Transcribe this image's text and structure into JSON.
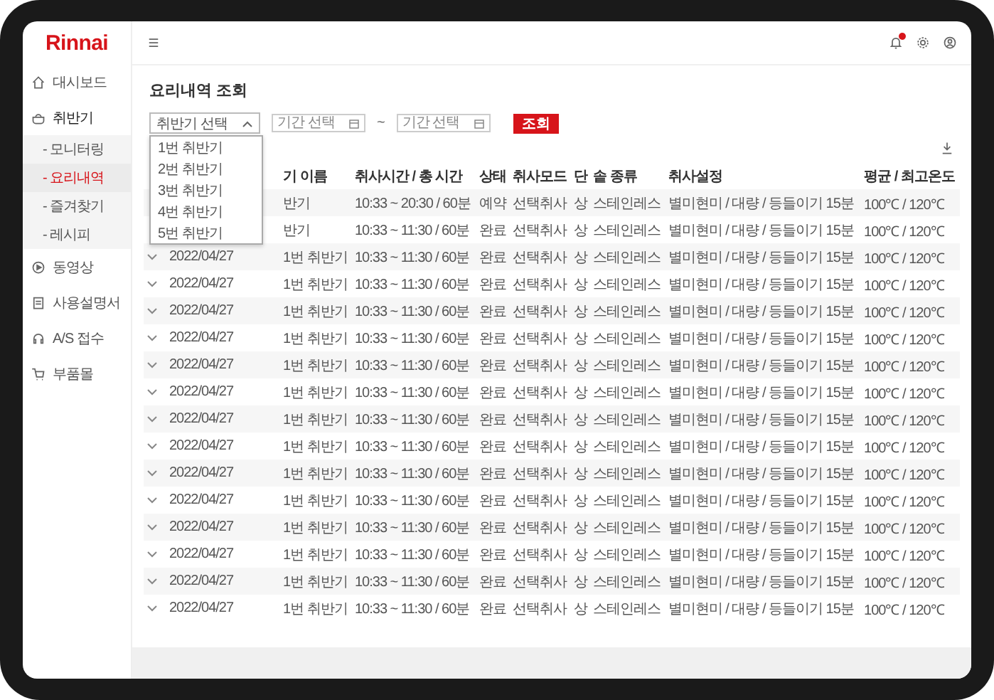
{
  "sidebar": {
    "logo": "Rinnai",
    "items": [
      {
        "label": "대시보드",
        "selected": false
      },
      {
        "label": "취반기",
        "selected": false,
        "expanded": true,
        "children": [
          {
            "label": "- 모니터링",
            "selected": false
          },
          {
            "label": "- 요리내역",
            "selected": true
          },
          {
            "label": "- 즐겨찾기",
            "selected": false
          },
          {
            "label": "- 레시피",
            "selected": false
          }
        ]
      },
      {
        "label": "동영상",
        "selected": false
      },
      {
        "label": "사용설명서",
        "selected": false
      },
      {
        "label": "A/S 접수",
        "selected": false
      },
      {
        "label": "부품몰",
        "selected": false
      }
    ]
  },
  "top_bar": {
    "notification": true
  },
  "page_title": "요리내역 조회",
  "filters": {
    "device_select": {
      "value": "취반기 선택",
      "expanded": true,
      "options": [
        {
          "label": "1번 취반기",
          "selected": false
        },
        {
          "label": "2번 취반기",
          "selected": false
        },
        {
          "label": "3번 취반기",
          "selected": false
        },
        {
          "label": "4번 취반기",
          "selected": false
        },
        {
          "label": "5번 취반기",
          "selected": false
        }
      ]
    },
    "date_from": {
      "placeholder": "기간 선택"
    },
    "separator": "~",
    "date_to": {
      "placeholder": "기간 선택"
    },
    "search_button": "조회"
  },
  "table": {
    "columns": [
      "기 이름",
      "취사시간 / 총 시간",
      "상태",
      "취사모드",
      "단",
      "솥 종류",
      "취사설정",
      "평균 / 최고온도"
    ],
    "rows": [
      {
        "name": "반기",
        "time": "10:33 ~ 20:30 / 60분",
        "status": "예약",
        "mode": "선택취사",
        "stage": "상",
        "pot": "스테인레스",
        "setting": "별미현미 / 대량 / 등들이기 15분",
        "temp": "100℃ / 120℃"
      },
      {
        "name": "반기",
        "time": "10:33 ~ 11:30 / 60분",
        "status": "완료",
        "mode": "선택취사",
        "stage": "상",
        "pot": "스테인레스",
        "setting": "별미현미 / 대량 / 등들이기 15분",
        "temp": "100℃ / 120℃"
      },
      {
        "expanded": false,
        "date": "2022/04/27",
        "name": "1번 취반기",
        "time": "10:33 ~ 11:30 / 60분",
        "status": "완료",
        "mode": "선택취사",
        "stage": "상",
        "pot": "스테인레스",
        "setting": "별미현미 / 대량 / 등들이기 15분",
        "temp": "100℃ / 120℃"
      },
      {
        "expanded": false,
        "date": "2022/04/27",
        "name": "1번 취반기",
        "time": "10:33 ~ 11:30 / 60분",
        "status": "완료",
        "mode": "선택취사",
        "stage": "상",
        "pot": "스테인레스",
        "setting": "별미현미 / 대량 / 등들이기 15분",
        "temp": "100℃ / 120℃"
      },
      {
        "expanded": false,
        "date": "2022/04/27",
        "name": "1번 취반기",
        "time": "10:33 ~ 11:30 / 60분",
        "status": "완료",
        "mode": "선택취사",
        "stage": "상",
        "pot": "스테인레스",
        "setting": "별미현미 / 대량 / 등들이기 15분",
        "temp": "100℃ / 120℃"
      },
      {
        "expanded": false,
        "date": "2022/04/27",
        "name": "1번 취반기",
        "time": "10:33 ~ 11:30 / 60분",
        "status": "완료",
        "mode": "선택취사",
        "stage": "상",
        "pot": "스테인레스",
        "setting": "별미현미 / 대량 / 등들이기 15분",
        "temp": "100℃ / 120℃"
      },
      {
        "expanded": false,
        "date": "2022/04/27",
        "name": "1번 취반기",
        "time": "10:33 ~ 11:30 / 60분",
        "status": "완료",
        "mode": "선택취사",
        "stage": "상",
        "pot": "스테인레스",
        "setting": "별미현미 / 대량 / 등들이기 15분",
        "temp": "100℃ / 120℃"
      },
      {
        "expanded": false,
        "date": "2022/04/27",
        "name": "1번 취반기",
        "time": "10:33 ~ 11:30 / 60분",
        "status": "완료",
        "mode": "선택취사",
        "stage": "상",
        "pot": "스테인레스",
        "setting": "별미현미 / 대량 / 등들이기 15분",
        "temp": "100℃ / 120℃"
      },
      {
        "expanded": false,
        "date": "2022/04/27",
        "name": "1번 취반기",
        "time": "10:33 ~ 11:30 / 60분",
        "status": "완료",
        "mode": "선택취사",
        "stage": "상",
        "pot": "스테인레스",
        "setting": "별미현미 / 대량 / 등들이기 15분",
        "temp": "100℃ / 120℃"
      },
      {
        "expanded": false,
        "date": "2022/04/27",
        "name": "1번 취반기",
        "time": "10:33 ~ 11:30 / 60분",
        "status": "완료",
        "mode": "선택취사",
        "stage": "상",
        "pot": "스테인레스",
        "setting": "별미현미 / 대량 / 등들이기 15분",
        "temp": "100℃ / 120℃"
      },
      {
        "expanded": false,
        "date": "2022/04/27",
        "name": "1번 취반기",
        "time": "10:33 ~ 11:30 / 60분",
        "status": "완료",
        "mode": "선택취사",
        "stage": "상",
        "pot": "스테인레스",
        "setting": "별미현미 / 대량 / 등들이기 15분",
        "temp": "100℃ / 120℃"
      },
      {
        "expanded": false,
        "date": "2022/04/27",
        "name": "1번 취반기",
        "time": "10:33 ~ 11:30 / 60분",
        "status": "완료",
        "mode": "선택취사",
        "stage": "상",
        "pot": "스테인레스",
        "setting": "별미현미 / 대량 / 등들이기 15분",
        "temp": "100℃ / 120℃"
      },
      {
        "expanded": false,
        "date": "2022/04/27",
        "name": "1번 취반기",
        "time": "10:33 ~ 11:30 / 60분",
        "status": "완료",
        "mode": "선택취사",
        "stage": "상",
        "pot": "스테인레스",
        "setting": "별미현미 / 대량 / 등들이기 15분",
        "temp": "100℃ / 120℃"
      },
      {
        "expanded": false,
        "date": "2022/04/27",
        "name": "1번 취반기",
        "time": "10:33 ~ 11:30 / 60분",
        "status": "완료",
        "mode": "선택취사",
        "stage": "상",
        "pot": "스테인레스",
        "setting": "별미현미 / 대량 / 등들이기 15분",
        "temp": "100℃ / 120℃"
      },
      {
        "expanded": false,
        "date": "2022/04/27",
        "name": "1번 취반기",
        "time": "10:33 ~ 11:30 / 60분",
        "status": "완료",
        "mode": "선택취사",
        "stage": "상",
        "pot": "스테인레스",
        "setting": "별미현미 / 대량 / 등들이기 15분",
        "temp": "100℃ / 120℃"
      },
      {
        "expanded": false,
        "date": "2022/04/27",
        "name": "1번 취반기",
        "time": "10:33 ~ 11:30 / 60분",
        "status": "완료",
        "mode": "선택취사",
        "stage": "상",
        "pot": "스테인레스",
        "setting": "별미현미 / 대량 / 등들이기 15분",
        "temp": "100℃ / 120℃"
      }
    ]
  }
}
